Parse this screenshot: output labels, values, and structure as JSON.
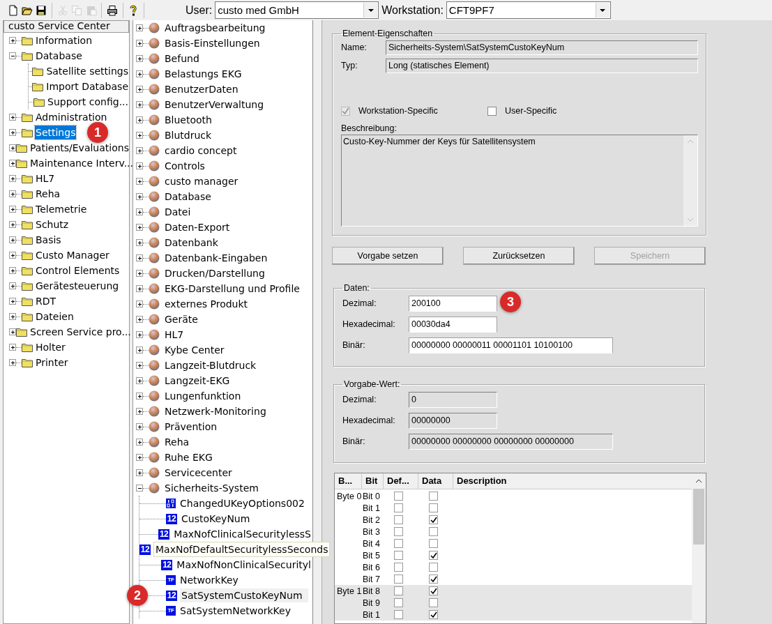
{
  "toolbar": {
    "buttons": [
      {
        "kind": "new",
        "disabled": false
      },
      {
        "kind": "open",
        "disabled": false
      },
      {
        "kind": "save",
        "disabled": false
      },
      {
        "kind": "cut",
        "disabled": true
      },
      {
        "kind": "copy",
        "disabled": true
      },
      {
        "kind": "paste",
        "disabled": true
      },
      {
        "kind": "print",
        "disabled": false
      },
      {
        "kind": "help",
        "disabled": false
      }
    ]
  },
  "user": {
    "label": "User:",
    "value": "custo med GmbH"
  },
  "workstation": {
    "label": "Workstation:",
    "value": "CFT9PF7"
  },
  "category_tree": {
    "title": "custo Service Center",
    "items": [
      {
        "label": "Information",
        "selected": false,
        "expanded": false
      },
      {
        "label": "Database",
        "selected": false,
        "expanded": true,
        "children": [
          {
            "label": "Satellite settings",
            "selected": false
          },
          {
            "label": "Import Database",
            "selected": false
          },
          {
            "label": "Support config...",
            "selected": false
          }
        ]
      },
      {
        "label": "Administration",
        "selected": false,
        "expanded": false
      },
      {
        "label": "Settings",
        "selected": true,
        "expanded": false,
        "marker": "1"
      },
      {
        "label": "Patients/Evaluations",
        "selected": false,
        "expanded": false
      },
      {
        "label": "Maintenance Interv...",
        "selected": false,
        "expanded": false
      },
      {
        "label": "HL7",
        "selected": false,
        "expanded": false
      },
      {
        "label": "Reha",
        "selected": false,
        "expanded": false
      },
      {
        "label": "Telemetrie",
        "selected": false,
        "expanded": false
      },
      {
        "label": "Schutz",
        "selected": false,
        "expanded": false
      },
      {
        "label": "Basis",
        "selected": false,
        "expanded": false
      },
      {
        "label": "Custo Manager",
        "selected": false,
        "expanded": false
      },
      {
        "label": "Control Elements",
        "selected": false,
        "expanded": false
      },
      {
        "label": "Gerätesteuerung",
        "selected": false,
        "expanded": false
      },
      {
        "label": "RDT",
        "selected": false,
        "expanded": false
      },
      {
        "label": "Dateien",
        "selected": false,
        "expanded": false
      },
      {
        "label": "Screen Service pro...",
        "selected": false,
        "expanded": false
      },
      {
        "label": "Holter",
        "selected": false,
        "expanded": false
      },
      {
        "label": "Printer",
        "selected": false,
        "expanded": false
      }
    ]
  },
  "settings_tree": {
    "items": [
      {
        "label": "Auftragsbearbeitung",
        "selected": false,
        "expanded": false
      },
      {
        "label": "Basis-Einstellungen",
        "selected": false,
        "expanded": false
      },
      {
        "label": "Befund",
        "selected": false,
        "expanded": false
      },
      {
        "label": "Belastungs EKG",
        "selected": false,
        "expanded": false
      },
      {
        "label": "BenutzerDaten",
        "selected": false,
        "expanded": false
      },
      {
        "label": "BenutzerVerwaltung",
        "selected": false,
        "expanded": false
      },
      {
        "label": "Bluetooth",
        "selected": false,
        "expanded": false
      },
      {
        "label": "Blutdruck",
        "selected": false,
        "expanded": false
      },
      {
        "label": "cardio concept",
        "selected": false,
        "expanded": false
      },
      {
        "label": "Controls",
        "selected": false,
        "expanded": false
      },
      {
        "label": "custo manager",
        "selected": false,
        "expanded": false
      },
      {
        "label": "Database",
        "selected": false,
        "expanded": false
      },
      {
        "label": "Datei",
        "selected": false,
        "expanded": false
      },
      {
        "label": "Daten-Export",
        "selected": false,
        "expanded": false
      },
      {
        "label": "Datenbank",
        "selected": false,
        "expanded": false
      },
      {
        "label": "Datenbank-Eingaben",
        "selected": false,
        "expanded": false
      },
      {
        "label": "Drucken/Darstellung",
        "selected": false,
        "expanded": false
      },
      {
        "label": "EKG-Darstellung und Profile",
        "selected": false,
        "expanded": false
      },
      {
        "label": "externes Produkt",
        "selected": false,
        "expanded": false
      },
      {
        "label": "Geräte",
        "selected": false,
        "expanded": false
      },
      {
        "label": "HL7",
        "selected": false,
        "expanded": false
      },
      {
        "label": "Kybe Center",
        "selected": false,
        "expanded": false
      },
      {
        "label": "Langzeit-Blutdruck",
        "selected": false,
        "expanded": false
      },
      {
        "label": "Langzeit-EKG",
        "selected": false,
        "expanded": false
      },
      {
        "label": "Lungenfunktion",
        "selected": false,
        "expanded": false
      },
      {
        "label": "Netzwerk-Monitoring",
        "selected": false,
        "expanded": false
      },
      {
        "label": "Prävention",
        "selected": false,
        "expanded": false
      },
      {
        "label": "Reha",
        "selected": false,
        "expanded": false
      },
      {
        "label": "Ruhe EKG",
        "selected": false,
        "expanded": false
      },
      {
        "label": "Servicecenter",
        "selected": false,
        "expanded": false
      },
      {
        "label": "Sicherheits-System",
        "selected": false,
        "expanded": true,
        "children": [
          {
            "label": "ChangedUKeyOptions002",
            "kind": "binary",
            "selected": false
          },
          {
            "label": "CustoKeyNum",
            "kind": "number",
            "badge": "12",
            "selected": false
          },
          {
            "label": "MaxNofClinicalSecuritylessS",
            "kind": "number",
            "badge": "12",
            "selected": false
          },
          {
            "label": "MaxNofDefaultSecuritylessSeconds",
            "kind": "number",
            "badge": "12",
            "selected": false,
            "tooltip": true
          },
          {
            "label": "MaxNofNonClinicalSecurityl",
            "kind": "number",
            "badge": "12",
            "selected": false
          },
          {
            "label": "NetworkKey",
            "kind": "text",
            "badge": "TF",
            "selected": false
          },
          {
            "label": "SatSystemCustoKeyNum",
            "kind": "number",
            "badge": "12",
            "selected": true,
            "marker": "2"
          },
          {
            "label": "SatSystemNetworkKey",
            "kind": "text",
            "badge": "TF",
            "selected": false
          }
        ]
      }
    ]
  },
  "properties": {
    "title": "Element-Eigenschaften",
    "name_label": "Name:",
    "name_value": "Sicherheits-System\\SatSystemCustoKeyNum",
    "type_label": "Typ:",
    "type_value": "Long (statisches Element)",
    "checkboxes": [
      {
        "label": "Workstation-Specific",
        "checked": true,
        "disabled": true
      },
      {
        "label": "User-Specific",
        "checked": false,
        "disabled": false
      }
    ],
    "description_label": "Beschreibung:",
    "description": "Custo-Key-Nummer der Keys für Satellitensystem"
  },
  "buttons": [
    {
      "label": "Vorgabe setzen",
      "disabled": false
    },
    {
      "label": "Zurücksetzen",
      "disabled": false
    },
    {
      "label": "Speichern",
      "disabled": true
    }
  ],
  "data": {
    "title": "Daten:",
    "editable": true,
    "fields": [
      {
        "label": "Dezimal:",
        "value": "200100",
        "wide": false,
        "marker": "3"
      },
      {
        "label": "Hexadecimal:",
        "value": "00030da4",
        "wide": false
      },
      {
        "label": "Binär:",
        "value": "00000000 00000011 00001101 10100100",
        "wide": true
      }
    ]
  },
  "default_value": {
    "title": "Vorgabe-Wert:",
    "editable": false,
    "fields": [
      {
        "label": "Dezimal:",
        "value": "0",
        "wide": false
      },
      {
        "label": "Hexadecimal:",
        "value": "00000000",
        "wide": false
      },
      {
        "label": "Binär:",
        "value": "00000000 00000000 00000000 00000000",
        "wide": true
      }
    ]
  },
  "bits_table": {
    "columns": [
      "B...",
      "Bit",
      "Def...",
      "Data",
      "Description"
    ],
    "rows": [
      {
        "byte": "Byte 0",
        "bit": "Bit 0",
        "default": false,
        "data": false,
        "highlighted": false
      },
      {
        "bit": "Bit 1",
        "default": false,
        "data": false,
        "highlighted": false
      },
      {
        "bit": "Bit 2",
        "default": false,
        "data": true,
        "highlighted": false
      },
      {
        "bit": "Bit 3",
        "default": false,
        "data": false,
        "highlighted": false
      },
      {
        "bit": "Bit 4",
        "default": false,
        "data": false,
        "highlighted": false
      },
      {
        "bit": "Bit 5",
        "default": false,
        "data": true,
        "highlighted": false
      },
      {
        "bit": "Bit 6",
        "default": false,
        "data": false,
        "highlighted": false
      },
      {
        "bit": "Bit 7",
        "default": false,
        "data": true,
        "highlighted": false
      },
      {
        "byte": "Byte 1",
        "bit": "Bit 8",
        "default": false,
        "data": true,
        "highlighted": true
      },
      {
        "bit": "Bit 9",
        "default": false,
        "data": false,
        "highlighted": true
      },
      {
        "bit": "Bit 1",
        "default": false,
        "data": true,
        "highlighted": true
      }
    ]
  }
}
